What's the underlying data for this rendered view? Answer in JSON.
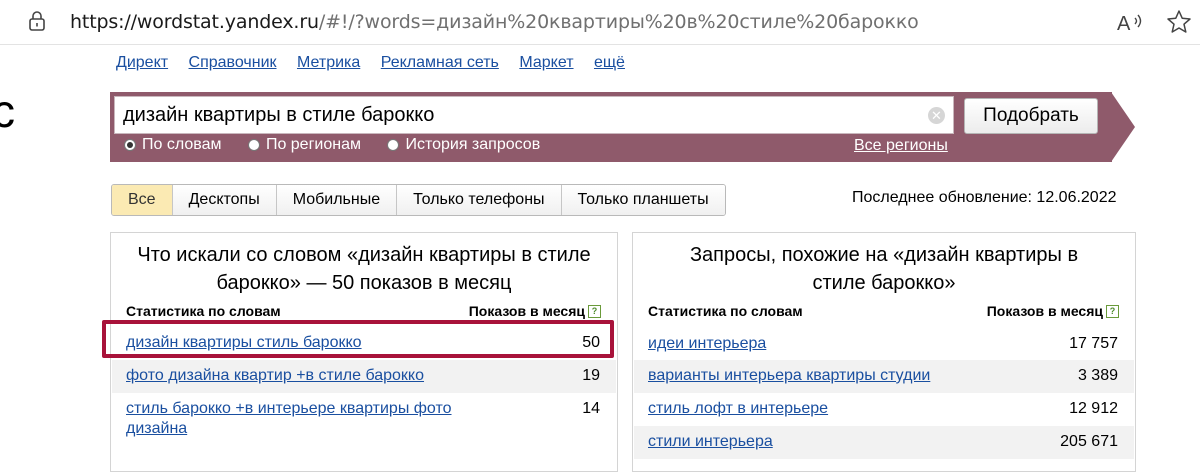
{
  "browser": {
    "url_host": "https://wordstat.yandex.ru",
    "url_path": "/#!/?words=дизайн%20квартиры%20в%20стиле%20барокко",
    "icons": [
      "lock-icon",
      "read-aloud-icon",
      "favorite-star-icon"
    ]
  },
  "services": [
    "Директ",
    "Справочник",
    "Метрика",
    "Рекламная сеть",
    "Маркет",
    "ещё"
  ],
  "logo_fragment": "с",
  "search": {
    "query": "дизайн квартиры в стиле барокко",
    "clear_glyph": "✕",
    "submit_label": "Подобрать",
    "radios": [
      {
        "label": "По словам",
        "checked": true
      },
      {
        "label": "По регионам",
        "checked": false
      },
      {
        "label": "История запросов",
        "checked": false
      }
    ],
    "regions_link": "Все регионы"
  },
  "tabs": [
    "Все",
    "Десктопы",
    "Мобильные",
    "Только телефоны",
    "Только планшеты"
  ],
  "active_tab": "Все",
  "last_update": "Последнее обновление: 12.06.2022",
  "left_panel": {
    "title": "Что искали со словом «дизайн квартиры в стиле барокко» — 50 показов в месяц",
    "col_words": "Статистика по словам",
    "col_count": "Показов в месяц",
    "help_glyph": "?",
    "rows": [
      {
        "phrase": "дизайн квартиры стиль барокко",
        "count": "50"
      },
      {
        "phrase": "фото дизайна квартир +в стиле барокко",
        "count": "19"
      },
      {
        "phrase": "стиль барокко +в интерьере квартиры фото дизайна",
        "count": "14"
      }
    ]
  },
  "right_panel": {
    "title": "Запросы, похожие на «дизайн квартиры в стиле барокко»",
    "col_words": "Статистика по словам",
    "col_count": "Показов в месяц",
    "help_glyph": "?",
    "rows": [
      {
        "phrase": "идеи интерьера",
        "count": "17 757"
      },
      {
        "phrase": "варианты интерьера квартиры студии",
        "count": "3 389"
      },
      {
        "phrase": "стиль лофт в интерьере",
        "count": "12 912"
      },
      {
        "phrase": "стили интерьера",
        "count": "205 671"
      }
    ]
  },
  "colors": {
    "band": "#8f5a6b",
    "link": "#1a4fa0",
    "active_tab": "#fbeab3",
    "highlight_box": "#a8123a"
  }
}
